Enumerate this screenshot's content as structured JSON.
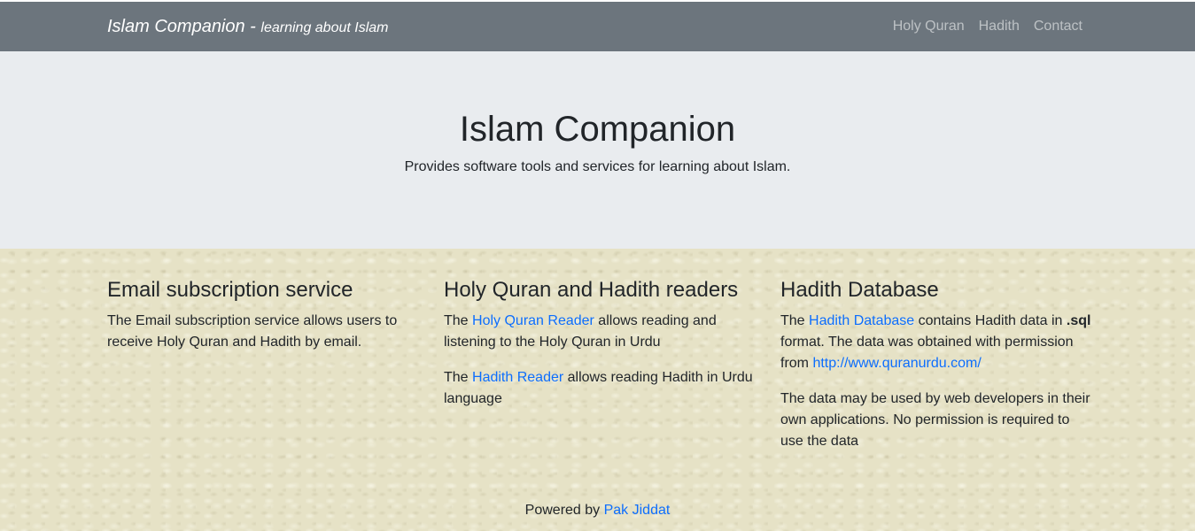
{
  "navbar": {
    "brand_title": "Islam Companion - ",
    "brand_tagline": "learning about Islam",
    "links": [
      "Holy Quran",
      "Hadith",
      "Contact"
    ]
  },
  "hero": {
    "title": "Islam Companion",
    "subtitle": "Provides software tools and services for learning about Islam."
  },
  "columns": {
    "email": {
      "heading": "Email subscription service",
      "text": "The Email subscription service allows users to receive Holy Quran and Hadith by email."
    },
    "readers": {
      "heading": "Holy Quran and Hadith readers",
      "p1_before": "The ",
      "p1_link": "Holy Quran Reader",
      "p1_after": " allows reading and listening to the Holy Quran in Urdu",
      "p2_before": "The ",
      "p2_link": "Hadith Reader",
      "p2_after": " allows reading Hadith in Urdu language"
    },
    "database": {
      "heading": "Hadith Database",
      "p1_before": "The ",
      "p1_link": "Hadith Database",
      "p1_mid": " contains Hadith data in ",
      "p1_bold": ".sql",
      "p1_after": " format. The data was obtained with permission from ",
      "p1_url": "http://www.quranurdu.com/",
      "p2": "The data may be used by web developers in their own applications. No permission is required to use the data"
    }
  },
  "footer": {
    "prefix": "Powered by ",
    "link": "Pak Jiddat"
  },
  "colors": {
    "navbar_bg": "#6c757d",
    "hero_bg": "#e9ecef",
    "link": "#0d6efd",
    "page_bg": "#e6e2c6"
  }
}
